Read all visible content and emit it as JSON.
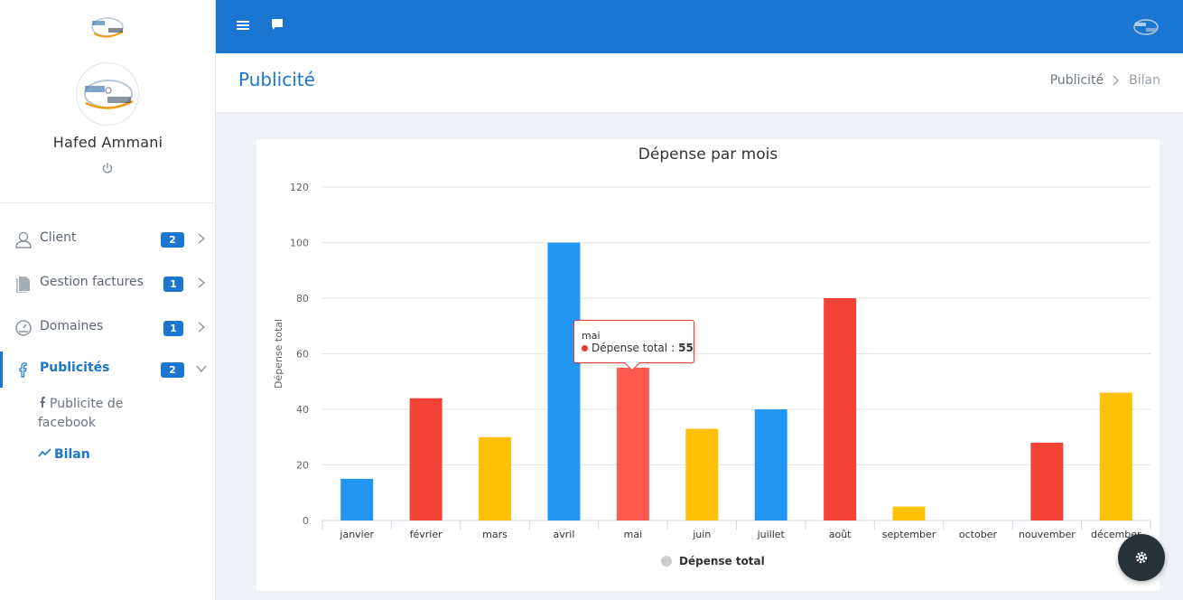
{
  "user": {
    "name": "Hafed Ammani"
  },
  "nav": {
    "items": [
      {
        "label": "Client",
        "badge": "2",
        "icon": "user-icon"
      },
      {
        "label": "Gestion factures",
        "badge": "1",
        "icon": "file-icon"
      },
      {
        "label": "Domaines",
        "badge": "1",
        "icon": "dashboard-icon"
      },
      {
        "label": "Publicités",
        "badge": "2",
        "icon": "facebook-icon"
      }
    ],
    "sub": [
      {
        "label": "Publicite de facebook",
        "icon": "facebook-icon"
      },
      {
        "label": "Bilan",
        "icon": "trend-icon"
      }
    ]
  },
  "page": {
    "title": "Publicité"
  },
  "breadcrumb": {
    "items": [
      "Publicité",
      "Bilan"
    ]
  },
  "colors": {
    "accent": "#1b76d2",
    "blue": "#2196f3",
    "red": "#f44336",
    "amber": "#ffc107",
    "hover_red": "#ff5a50"
  },
  "chart_data": {
    "type": "bar",
    "title": "Dépense par mois",
    "xlabel": "",
    "ylabel": "Dépense total",
    "ylim": [
      0,
      120
    ],
    "yticks": [
      0,
      20,
      40,
      60,
      80,
      100,
      120
    ],
    "grid": true,
    "legend_position": "bottom",
    "categories": [
      "janvier",
      "février",
      "mars",
      "avril",
      "mai",
      "juin",
      "juillet",
      "août",
      "september",
      "october",
      "nouvember",
      "décember"
    ],
    "series": [
      {
        "name": "Dépense total",
        "values": [
          15,
          44,
          30,
          100,
          55,
          33,
          40,
          80,
          5,
          0,
          28,
          46
        ]
      }
    ],
    "bar_colors": [
      "#2196f3",
      "#f44336",
      "#ffc107",
      "#2196f3",
      "#ff5a50",
      "#ffc107",
      "#2196f3",
      "#f44336",
      "#ffc107",
      "#2196f3",
      "#f44336",
      "#ffc107"
    ],
    "tooltip": {
      "category": "mai",
      "series": "Dépense total",
      "value": "55"
    }
  }
}
